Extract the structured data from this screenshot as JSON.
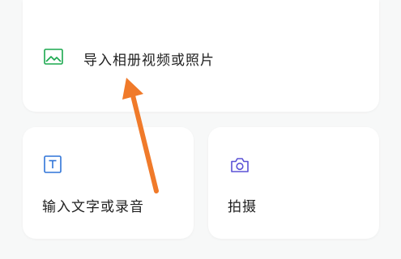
{
  "options": {
    "import_media": {
      "label": "导入相册视频或照片",
      "icon": "image-icon",
      "icon_color": "#1aa84e"
    },
    "input_text_or_audio": {
      "label": "输入文字或录音",
      "icon": "text-box-icon",
      "icon_color": "#2f74d8"
    },
    "take_photo": {
      "label": "拍摄",
      "icon": "camera-icon",
      "icon_color": "#5b52d6"
    }
  },
  "annotation": {
    "color": "#f07a2a",
    "icon": "arrow-up-icon"
  }
}
